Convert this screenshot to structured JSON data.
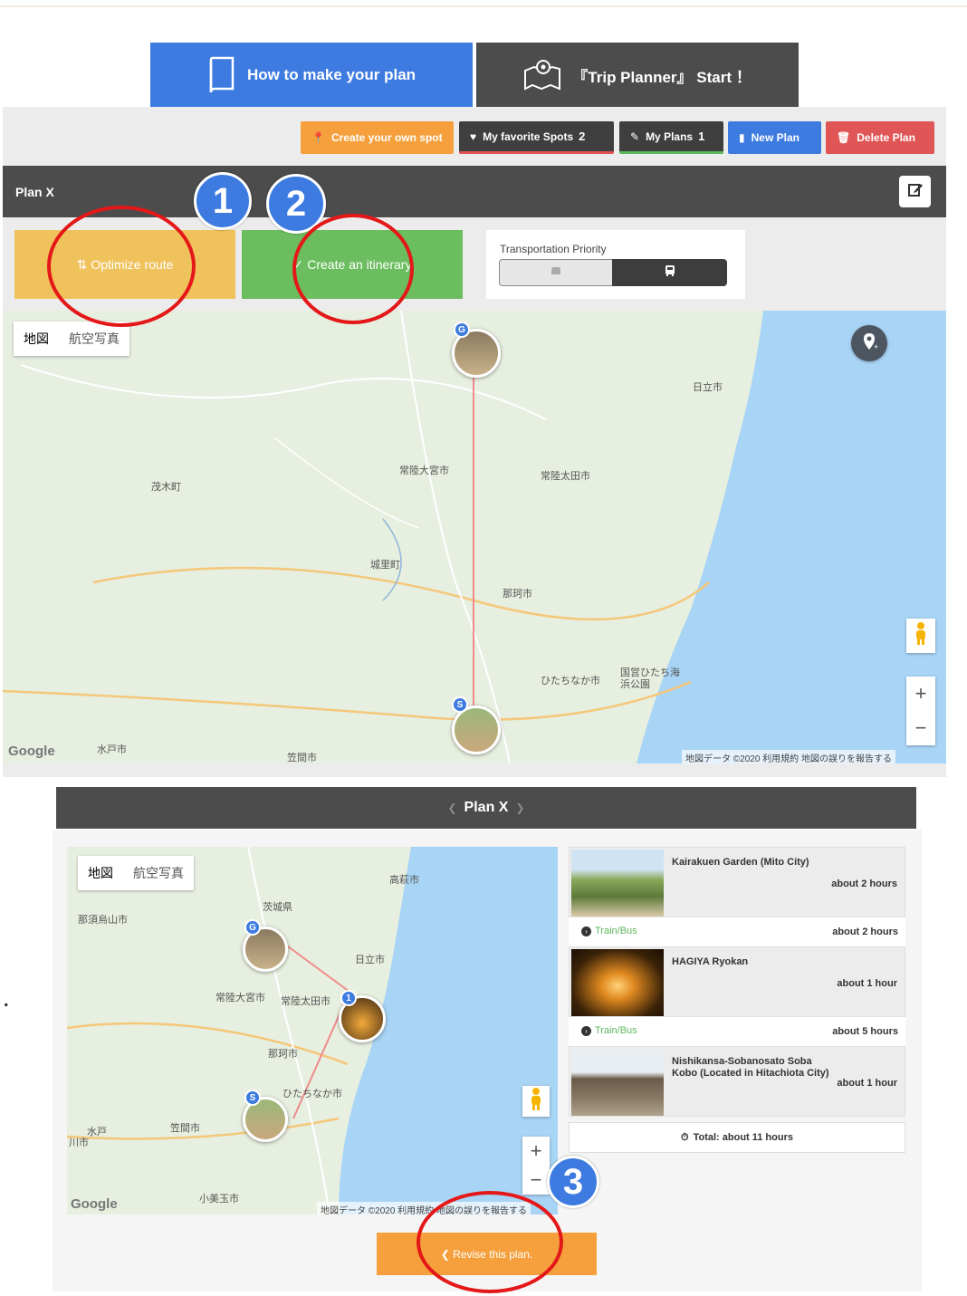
{
  "tabs": {
    "howto": "How to make your plan",
    "start": "『Trip Planner』 Start ！"
  },
  "actions": {
    "create_spot": "Create your own spot",
    "favorites_label": "My favorite Spots",
    "favorites_count": "2",
    "myplans_label": "My Plans",
    "myplans_count": "1",
    "new_plan": "New Plan",
    "delete_plan": "Delete Plan"
  },
  "plan": {
    "title": "Plan X"
  },
  "buttons": {
    "optimize": "Optimize route",
    "itinerary": "Create an itinerary"
  },
  "transport": {
    "label": "Transportation Priority",
    "selected": "train"
  },
  "map1": {
    "type_map": "地図",
    "type_satellite": "航空写真",
    "google": "Google",
    "footer": "地図データ ©2020  利用規約  地図の誤りを報告する",
    "labels": [
      "日立市",
      "常陸大宮市",
      "常陸太田市",
      "茂木町",
      "城里町",
      "那珂市",
      "ひたちなか市",
      "国営ひたち海浜公園",
      "笠間市",
      "水戸市"
    ],
    "pin_start": "S",
    "pin_goal": "G",
    "zoom_in": "+",
    "zoom_out": "−"
  },
  "plan2": {
    "title": "Plan X",
    "prev": "❮",
    "next": "❯"
  },
  "map2": {
    "type_map": "地図",
    "type_satellite": "航空写真",
    "google": "Google",
    "footer": "地図データ ©2020  利用規約  地図の誤りを報告する",
    "labels": [
      "高萩市",
      "茨城県",
      "那須烏山市",
      "日立市",
      "常陸大宮市",
      "常陸太田市",
      "那珂市",
      "ひたちなか市",
      "笠間市",
      "小美玉市",
      "水戸",
      "川市"
    ],
    "pin_start": "S",
    "pin_goal": "G",
    "pin_one": "1",
    "zoom_in": "+",
    "zoom_out": "−"
  },
  "itinerary": {
    "spots": [
      {
        "name": "Kairakuen Garden (Mito City)",
        "duration": "about 2 hours"
      },
      {
        "name": "HAGIYA Ryokan",
        "duration": "about 1 hour"
      },
      {
        "name": "Nishikansa-Sobanosato Soba Kobo (Located in Hitachiota City)",
        "duration": "about 1 hour"
      }
    ],
    "travels": [
      {
        "mode": "Train/Bus",
        "duration": "about 2 hours"
      },
      {
        "mode": "Train/Bus",
        "duration": "about 5 hours"
      }
    ],
    "total": "Total: about 11 hours"
  },
  "revise": "❮ Revise this plan.",
  "annotations": {
    "one": "1",
    "two": "2",
    "three": "3"
  },
  "side_mark": "."
}
